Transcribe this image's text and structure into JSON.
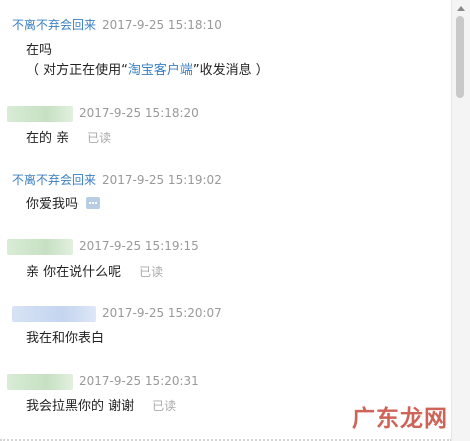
{
  "messages": [
    {
      "sender": "不离不弃会回来",
      "time": "2017-9-25 15:18:10",
      "lines": [
        "在吗"
      ],
      "note_prefix": "（ 对方正在使用“",
      "note_link": "淘宝客户端",
      "note_suffix": "”收发消息 ）"
    },
    {
      "time": "2017-9-25 15:18:20",
      "text": "在的 亲",
      "status": "已读"
    },
    {
      "sender": "不离不弃会回来",
      "time": "2017-9-25 15:19:02",
      "text": "你爱我吗",
      "emoji": "message-emoji-icon"
    },
    {
      "time": "2017-9-25 15:19:15",
      "text": "亲 你在说什么呢",
      "status": "已读"
    },
    {
      "time": "2017-9-25 15:20:07",
      "text": "我在和你表白"
    },
    {
      "time": "2017-9-25 15:20:31",
      "text": "我会拉黑你的 谢谢",
      "status": "已读"
    }
  ],
  "watermark": "广东龙网",
  "colors": {
    "sender": "#3a7fc1",
    "timestamp": "#999999",
    "watermark": "#c64a3c"
  }
}
